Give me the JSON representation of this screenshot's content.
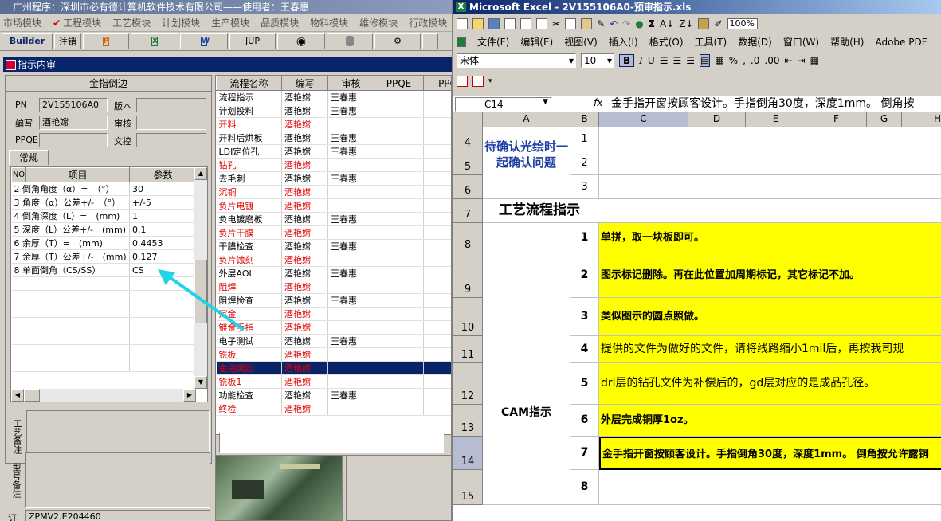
{
  "left_app": {
    "title": "广州程序：深圳市必有德计算机软件技术有限公司——使用者：王春惠",
    "menu": [
      "市场模块",
      "工程模块",
      "工艺模块",
      "计划模块",
      "生产模块",
      "品质模块",
      "物料模块",
      "维修模块",
      "行政模块"
    ],
    "toolbar": {
      "builder": "Builder",
      "logout": "注销",
      "jup": "JUP"
    },
    "panel_title": "指示内审",
    "group_title": "金指倒边",
    "fields": {
      "pn_label": "PN",
      "pn_value": "2V155106A0",
      "version_label": "版本",
      "writer_label": "编写",
      "writer_value": "酒艳嫦",
      "review_label": "审核",
      "ppqe_label": "PPQE",
      "doc_label": "文控"
    },
    "tab_label": "常规",
    "param_headers": [
      "NO",
      "项目",
      "参数"
    ],
    "params": [
      {
        "item": "2 倒角角度（α）=　（°）",
        "value": "30"
      },
      {
        "item": "3 角度（α）公差+/-　（°）",
        "value": "+/-5"
      },
      {
        "item": "4 倒角深度（L）=　(mm)",
        "value": "1"
      },
      {
        "item": "5 深度（L）公差+/-　(mm)",
        "value": "0.1"
      },
      {
        "item": "6 余厚（T）=　(mm)",
        "value": "0.4453"
      },
      {
        "item": "7 余厚（T）公差+/-　(mm)",
        "value": "0.127"
      },
      {
        "item": "8 单面倒角（CS/SS）",
        "value": "CS"
      }
    ],
    "note_labels": [
      "工艺备注",
      "型号备注"
    ],
    "bottom_label": "订",
    "bottom_value": "ZPMV2.E204460",
    "flow_headers": [
      "流程名称",
      "编写",
      "审核",
      "PPQE",
      "PPC"
    ],
    "flows": [
      {
        "name": "流程指示",
        "writer": "酒艳嫦",
        "reviewer": "王春惠",
        "red": false
      },
      {
        "name": "计划投料",
        "writer": "酒艳嫦",
        "reviewer": "王春惠",
        "red": false
      },
      {
        "name": "开料",
        "writer": "酒艳嫦",
        "reviewer": "",
        "red": true
      },
      {
        "name": "开料后烘板",
        "writer": "酒艳嫦",
        "reviewer": "王春惠",
        "red": false
      },
      {
        "name": "LDI定位孔",
        "writer": "酒艳嫦",
        "reviewer": "王春惠",
        "red": false
      },
      {
        "name": "钻孔",
        "writer": "酒艳嫦",
        "reviewer": "",
        "red": true
      },
      {
        "name": "去毛刺",
        "writer": "酒艳嫦",
        "reviewer": "王春惠",
        "red": false
      },
      {
        "name": "沉铜",
        "writer": "酒艳嫦",
        "reviewer": "",
        "red": true
      },
      {
        "name": "负片电镀",
        "writer": "酒艳嫦",
        "reviewer": "",
        "red": true
      },
      {
        "name": "负电镀磨板",
        "writer": "酒艳嫦",
        "reviewer": "王春惠",
        "red": false
      },
      {
        "name": "负片干膜",
        "writer": "酒艳嫦",
        "reviewer": "",
        "red": true
      },
      {
        "name": "干膜检查",
        "writer": "酒艳嫦",
        "reviewer": "王春惠",
        "red": false
      },
      {
        "name": "负片蚀刻",
        "writer": "酒艳嫦",
        "reviewer": "",
        "red": true
      },
      {
        "name": "外层AOI",
        "writer": "酒艳嫦",
        "reviewer": "王春惠",
        "red": false
      },
      {
        "name": "阻焊",
        "writer": "酒艳嫦",
        "reviewer": "",
        "red": true
      },
      {
        "name": "阻焊检查",
        "writer": "酒艳嫦",
        "reviewer": "王春惠",
        "red": false
      },
      {
        "name": "沉金",
        "writer": "酒艳嫦",
        "reviewer": "",
        "red": true
      },
      {
        "name": "镀金手指",
        "writer": "酒艳嫦",
        "reviewer": "",
        "red": true
      },
      {
        "name": "电子测试",
        "writer": "酒艳嫦",
        "reviewer": "王春惠",
        "red": false
      },
      {
        "name": "铣板",
        "writer": "酒艳嫦",
        "reviewer": "",
        "red": true
      },
      {
        "name": "金指倒边",
        "writer": "酒艳嫦",
        "reviewer": "",
        "red": true,
        "selected": true
      },
      {
        "name": "铣板1",
        "writer": "酒艳嫦",
        "reviewer": "",
        "red": true
      },
      {
        "name": "功能检查",
        "writer": "酒艳嫦",
        "reviewer": "王春惠",
        "red": false
      },
      {
        "name": "终检",
        "writer": "酒艳嫦",
        "reviewer": "",
        "red": true
      }
    ]
  },
  "excel": {
    "title": "Microsoft Excel - 2V155106A0-预审指示.xls",
    "menu": [
      "文件(F)",
      "编辑(E)",
      "视图(V)",
      "插入(I)",
      "格式(O)",
      "工具(T)",
      "数据(D)",
      "窗口(W)",
      "帮助(H)",
      "Adobe PDF"
    ],
    "font_name": "宋体",
    "font_size": "10",
    "zoom": "100%",
    "name_box": "C14",
    "formula": "金手指开窗按顾客设计。手指倒角30度，深度1mm。 倒角按",
    "columns": [
      "A",
      "B",
      "C",
      "D",
      "E",
      "F",
      "G",
      "H"
    ],
    "rows": [
      "4",
      "5",
      "6",
      "7",
      "8",
      "9",
      "10",
      "11",
      "12",
      "13",
      "14",
      "15"
    ],
    "a_confirm": "待确认光绘时一起确认问题",
    "a_flow": "工艺流程指示",
    "a_cam": "CAM指示",
    "b_top": [
      "1",
      "2",
      "3"
    ],
    "cam_items": [
      {
        "no": "1",
        "text": "单拼，取一块板即可。",
        "bold": true
      },
      {
        "no": "2",
        "text": "图示标记删除。再在此位置加周期标记，其它标记不加。",
        "bold": true
      },
      {
        "no": "3",
        "text": "类似图示的圆点照做。",
        "bold": true
      },
      {
        "no": "4",
        "text": "提供的文件为做好的文件，请将线路缩小1mil后，再按我司规",
        "bold": false
      },
      {
        "no": "5",
        "text": "drl层的钻孔文件为补偿后的，gd层对应的是成品孔径。",
        "bold": false
      },
      {
        "no": "6",
        "text": "外层完成铜厚1oz。",
        "bold": true
      },
      {
        "no": "7",
        "text": "金手指开窗按顾客设计。手指倒角30度，深度1mm。 倒角按允许露铜",
        "bold": true
      },
      {
        "no": "8",
        "text": "",
        "bold": false
      }
    ]
  }
}
